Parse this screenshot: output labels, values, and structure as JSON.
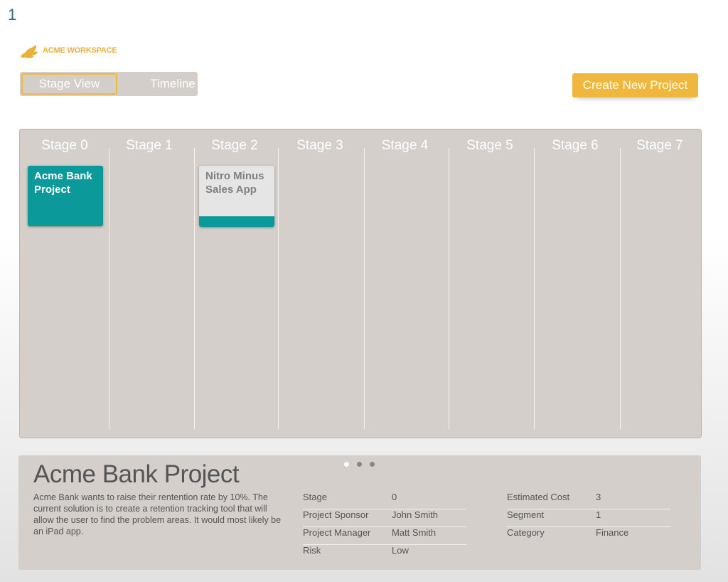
{
  "page_number": "1",
  "brand": {
    "name": "ACME WORKSPACE"
  },
  "view_toggle": {
    "stage_view": "Stage View",
    "timeline": "Timeline"
  },
  "actions": {
    "create_project": "Create New Project"
  },
  "board": {
    "stages": [
      "Stage 0",
      "Stage 1",
      "Stage 2",
      "Stage 3",
      "Stage 4",
      "Stage 5",
      "Stage 6",
      "Stage 7"
    ],
    "cards": [
      {
        "title": "Acme Bank Project",
        "stage": "Stage 0",
        "selected": true
      },
      {
        "title": "Nitro Minus Sales App",
        "stage": "Stage 2",
        "selected": false
      }
    ]
  },
  "details": {
    "title": "Acme Bank Project",
    "description": "Acme Bank wants to raise their rentention rate by 10%. The current solution is to create a retention tracking tool that will allow the user to find the problem areas. It would most likely be an iPad app.",
    "properties_left": [
      {
        "label": "Stage",
        "value": "0"
      },
      {
        "label": "Project Sponsor",
        "value": "John Smith"
      },
      {
        "label": "Project Manager",
        "value": "Matt Smith"
      },
      {
        "label": "Risk",
        "value": "Low"
      }
    ],
    "properties_right": [
      {
        "label": "Estimated Cost",
        "value": "3"
      },
      {
        "label": "Segment",
        "value": "1"
      },
      {
        "label": "Category",
        "value": "Finance"
      }
    ],
    "pager": {
      "pages": 3,
      "current": 1
    }
  },
  "colors": {
    "accent": "#f0b73e",
    "teal": "#0b9a99",
    "panel": "#d4cfca"
  }
}
